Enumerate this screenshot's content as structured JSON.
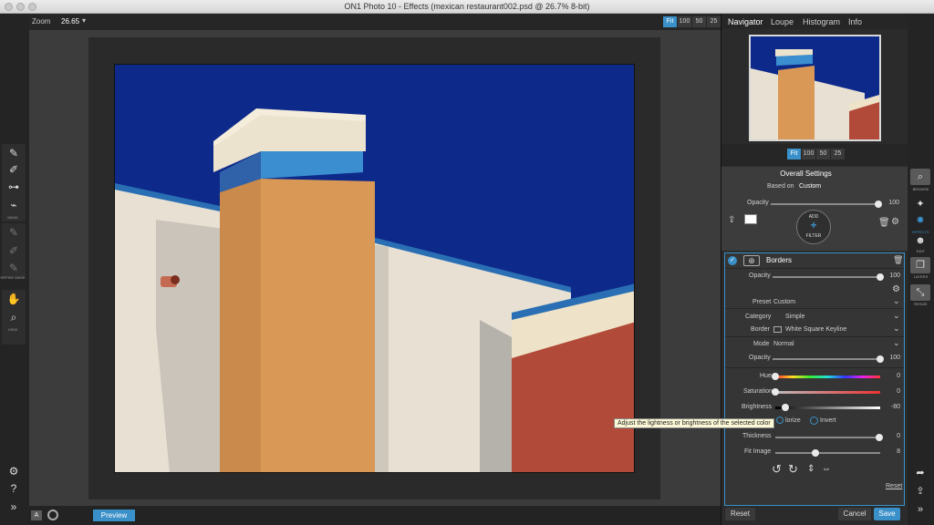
{
  "window": {
    "title": "ON1 Photo 10 - Effects (mexican restaurant002.psd @ 26.7% 8-bit)"
  },
  "toolbar": {
    "zoom_label": "Zoom",
    "zoom_value": "26.65",
    "zoom_buttons": [
      "Fit",
      "100",
      "50",
      "25"
    ]
  },
  "left_tools": {
    "mask_caption": "MASK",
    "refine_caption": "REFINE MASK",
    "view_caption": "VIEW"
  },
  "bottom": {
    "a_label": "A",
    "preview_label": "Preview"
  },
  "panel": {
    "tabs": [
      "Navigator",
      "Loupe",
      "Histogram",
      "Info"
    ],
    "nav_zoom_buttons": [
      "Fit",
      "100",
      "50",
      "25"
    ],
    "overall": {
      "title": "Overall Settings",
      "based_on_label": "Based on",
      "based_on_value": "Custom",
      "opacity_label": "Opacity",
      "opacity_value": "100",
      "add_label": "ADD",
      "filter_label": "FILTER"
    },
    "borders": {
      "title": "Borders",
      "opacity_label": "Opacity",
      "opacity_value": "100",
      "preset_label": "Preset",
      "preset_value": "Custom",
      "category_label": "Category",
      "category_value": "Simple",
      "border_label": "Border",
      "border_value": "White Square Keyline",
      "mode_label": "Mode",
      "mode_value": "Normal",
      "opacity2_label": "Opacity",
      "opacity2_value": "100",
      "hue_label": "Hue",
      "hue_value": "0",
      "saturation_label": "Saturation",
      "saturation_value": "0",
      "brightness_label": "Brightness",
      "brightness_value": "-80",
      "colorize_label": "lorize",
      "invert_label": "Invert",
      "thickness_label": "Thickness",
      "thickness_value": "0",
      "fit_label": "Fit Image",
      "fit_value": "8",
      "reset_label": "Reset"
    },
    "tooltip": "Adjust the lightness or brightness of the selected color"
  },
  "right_strip": {
    "captions": [
      "BROWSE",
      "EFFECTS",
      "EDIT",
      "LAYERS",
      "RESIZE"
    ]
  },
  "footer": {
    "reset_label": "Reset",
    "cancel_label": "Cancel",
    "save_label": "Save"
  },
  "colors": {
    "accent": "#3a90c8",
    "sky": "#0d2a8a",
    "orange": "#d99855",
    "brick": "#b14a38",
    "wall": "#e9e2d4"
  }
}
